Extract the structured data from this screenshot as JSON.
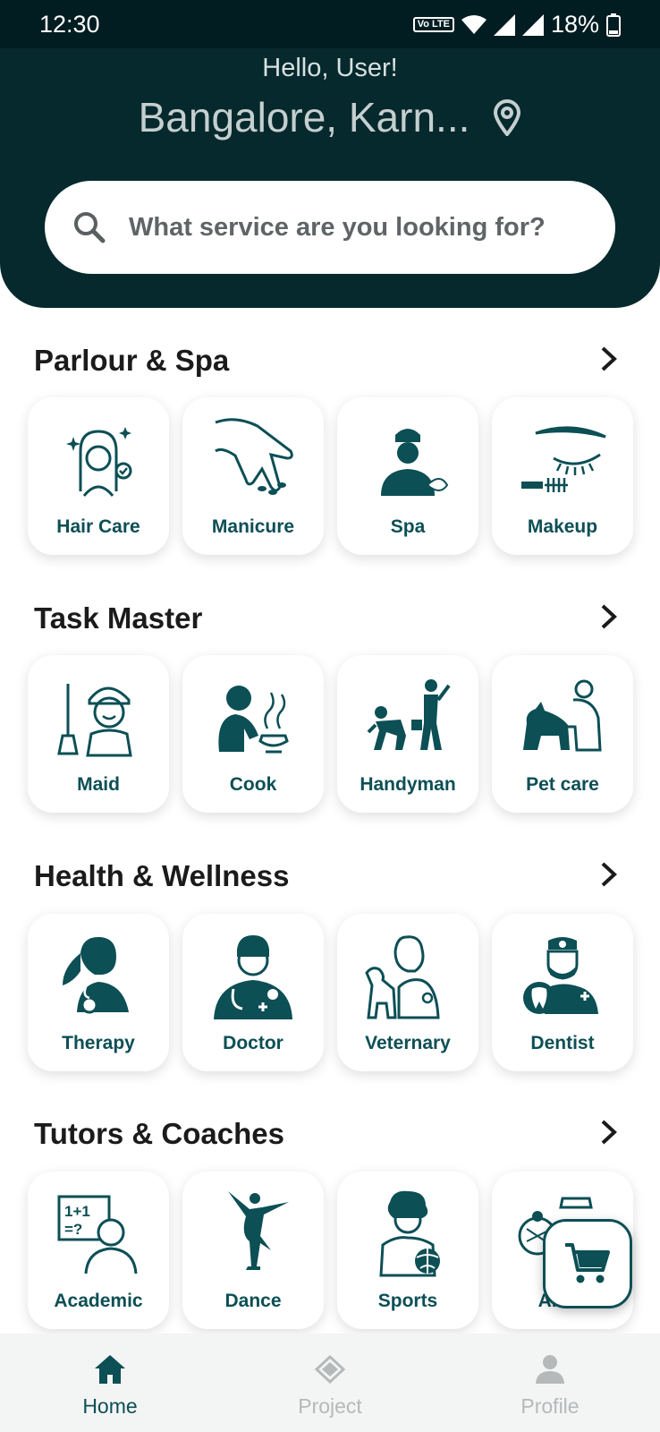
{
  "status_bar": {
    "time": "12:30",
    "network_badge": "Vo LTE",
    "battery": "18%"
  },
  "header": {
    "greeting": "Hello, User!",
    "location": "Bangalore, Karn...",
    "search_placeholder": "What service are you looking for?"
  },
  "sections": [
    {
      "title": "Parlour & Spa",
      "items": [
        {
          "label": "Hair Care",
          "icon": "hair-care-icon"
        },
        {
          "label": "Manicure",
          "icon": "manicure-icon"
        },
        {
          "label": "Spa",
          "icon": "spa-icon"
        },
        {
          "label": "Makeup",
          "icon": "makeup-icon"
        }
      ]
    },
    {
      "title": "Task Master",
      "items": [
        {
          "label": "Maid",
          "icon": "maid-icon"
        },
        {
          "label": "Cook",
          "icon": "cook-icon"
        },
        {
          "label": "Handyman",
          "icon": "handyman-icon"
        },
        {
          "label": "Pet care",
          "icon": "pet-care-icon"
        }
      ]
    },
    {
      "title": "Health & Wellness",
      "items": [
        {
          "label": "Therapy",
          "icon": "therapy-icon"
        },
        {
          "label": "Doctor",
          "icon": "doctor-icon"
        },
        {
          "label": "Veternary",
          "icon": "veterinary-icon"
        },
        {
          "label": "Dentist",
          "icon": "dentist-icon"
        }
      ]
    },
    {
      "title": "Tutors & Coaches",
      "items": [
        {
          "label": "Academic",
          "icon": "academic-icon"
        },
        {
          "label": "Dance",
          "icon": "dance-icon"
        },
        {
          "label": "Sports",
          "icon": "sports-icon"
        },
        {
          "label": "Artist",
          "icon": "artist-icon"
        }
      ]
    }
  ],
  "nav": {
    "home": "Home",
    "project": "Project",
    "profile": "Profile"
  },
  "colors": {
    "header_bg": "#05292d",
    "accent": "#0c4f55",
    "active_nav": "#0c4f55",
    "inactive_nav": "#b5b9ba"
  }
}
